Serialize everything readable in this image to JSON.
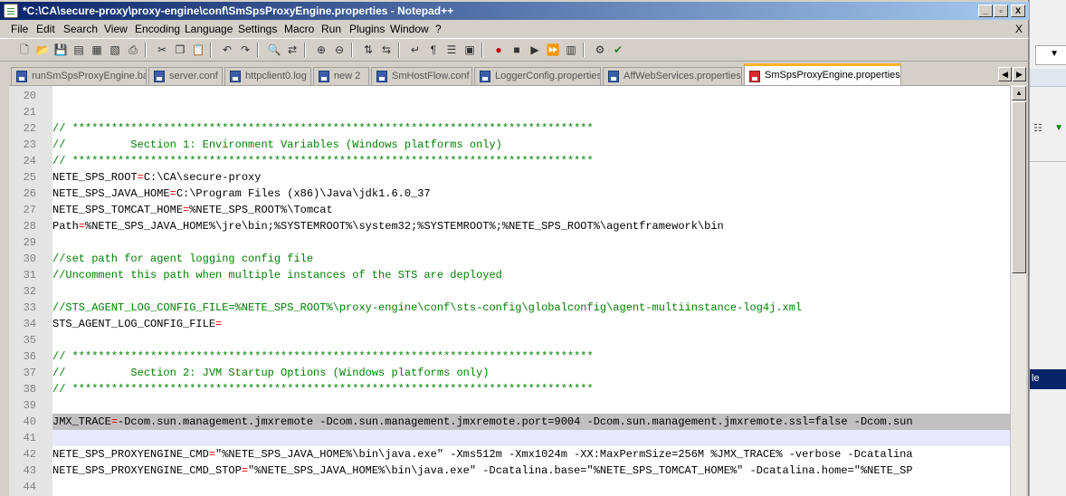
{
  "window": {
    "title": "*C:\\CA\\secure-proxy\\proxy-engine\\conf\\SmSpsProxyEngine.properties - Notepad++",
    "minimize_glyph": "_",
    "restore_glyph": "▫",
    "close_glyph": "X"
  },
  "menu": {
    "items": [
      "File",
      "Edit",
      "Search",
      "View",
      "Encoding",
      "Language",
      "Settings",
      "Macro",
      "Run",
      "Plugins",
      "Window",
      "?"
    ],
    "doc_close": "X"
  },
  "toolbar": {
    "icons": [
      "new-file-icon",
      "open-file-icon",
      "save-icon",
      "save-all-icon",
      "close-file-icon",
      "close-all-icon",
      "print-icon",
      "cut-icon",
      "copy-icon",
      "paste-icon",
      "undo-icon",
      "redo-icon",
      "find-icon",
      "replace-icon",
      "zoom-in-icon",
      "zoom-out-icon",
      "sync-vertical-icon",
      "sync-horizontal-icon",
      "word-wrap-icon",
      "show-all-chars-icon",
      "indent-guide-icon",
      "user-language-icon",
      "record-macro-icon",
      "stop-recording-icon",
      "play-macro-icon",
      "run-macro-multiple-icon",
      "save-macro-icon",
      "plugin-icon",
      "spell-check-icon"
    ]
  },
  "tabs": [
    {
      "label": "runSmSpsProxyEngine.bat",
      "active": false
    },
    {
      "label": "server.conf",
      "active": false
    },
    {
      "label": "httpclient0.log",
      "active": false
    },
    {
      "label": "new  2",
      "active": false
    },
    {
      "label": "SmHostFlow.conf",
      "active": false
    },
    {
      "label": "LoggerConfig.properties",
      "active": false
    },
    {
      "label": "AffWebServices.properties",
      "active": false
    },
    {
      "label": "SmSpsProxyEngine.properties",
      "active": true
    }
  ],
  "tab_scroll": {
    "left": "◀",
    "right": "▶"
  },
  "editor": {
    "lines": [
      {
        "n": "20",
        "parts": []
      },
      {
        "n": "21",
        "parts": []
      },
      {
        "n": "22",
        "parts": [
          {
            "t": "c",
            "s": "// ********************************************************************************"
          }
        ]
      },
      {
        "n": "23",
        "parts": [
          {
            "t": "c",
            "s": "//          Section 1: Environment Variables (Windows platforms only)"
          }
        ]
      },
      {
        "n": "24",
        "parts": [
          {
            "t": "c",
            "s": "// ********************************************************************************"
          }
        ]
      },
      {
        "n": "25",
        "parts": [
          {
            "t": "k",
            "s": "NETE_SPS_ROOT"
          },
          {
            "t": "eq",
            "s": "="
          },
          {
            "t": "v",
            "s": "C:\\CA\\secure-proxy"
          }
        ]
      },
      {
        "n": "26",
        "parts": [
          {
            "t": "k",
            "s": "NETE_SPS_JAVA_HOME"
          },
          {
            "t": "eq",
            "s": "="
          },
          {
            "t": "v",
            "s": "C:\\Program Files (x86)\\Java\\jdk1.6.0_37"
          }
        ]
      },
      {
        "n": "27",
        "parts": [
          {
            "t": "k",
            "s": "NETE_SPS_TOMCAT_HOME"
          },
          {
            "t": "eq",
            "s": "="
          },
          {
            "t": "v",
            "s": "%NETE_SPS_ROOT%\\Tomcat"
          }
        ]
      },
      {
        "n": "28",
        "parts": [
          {
            "t": "k",
            "s": "Path"
          },
          {
            "t": "eq",
            "s": "="
          },
          {
            "t": "v",
            "s": "%NETE_SPS_JAVA_HOME%\\jre\\bin;%SYSTEMROOT%\\system32;%SYSTEMROOT%;%NETE_SPS_ROOT%\\agentframework\\bin"
          }
        ]
      },
      {
        "n": "29",
        "parts": []
      },
      {
        "n": "30",
        "parts": [
          {
            "t": "c",
            "s": "//set path for agent logging config file"
          }
        ]
      },
      {
        "n": "31",
        "parts": [
          {
            "t": "c",
            "s": "//Uncomment this path when multiple instances of the STS are deployed"
          }
        ]
      },
      {
        "n": "32",
        "parts": []
      },
      {
        "n": "33",
        "parts": [
          {
            "t": "c",
            "s": "//STS_AGENT_LOG_CONFIG_FILE=%NETE_SPS_ROOT%\\proxy-engine\\conf\\sts-config\\globalconfig\\agent-multiinstance-log4j.xml"
          }
        ]
      },
      {
        "n": "34",
        "parts": [
          {
            "t": "k",
            "s": "STS_AGENT_LOG_CONFIG_FILE"
          },
          {
            "t": "eq",
            "s": "="
          }
        ]
      },
      {
        "n": "35",
        "parts": []
      },
      {
        "n": "36",
        "parts": [
          {
            "t": "c",
            "s": "// ********************************************************************************"
          }
        ]
      },
      {
        "n": "37",
        "parts": [
          {
            "t": "c",
            "s": "//          Section 2: JVM Startup Options (Windows platforms only)"
          }
        ]
      },
      {
        "n": "38",
        "parts": [
          {
            "t": "c",
            "s": "// ********************************************************************************"
          }
        ]
      },
      {
        "n": "39",
        "parts": []
      },
      {
        "n": "40",
        "sel": true,
        "parts": [
          {
            "t": "k",
            "s": "JMX_TRACE"
          },
          {
            "t": "eq",
            "s": "="
          },
          {
            "t": "v",
            "s": "-Dcom.sun.management.jmxremote -Dcom.sun.management.jmxremote.port=9004 -Dcom.sun.management.jmxremote.ssl=false -Dcom.sun"
          }
        ]
      },
      {
        "n": "41",
        "cur": true,
        "parts": []
      },
      {
        "n": "42",
        "parts": [
          {
            "t": "k",
            "s": "NETE_SPS_PROXYENGINE_CMD"
          },
          {
            "t": "eq",
            "s": "="
          },
          {
            "t": "v",
            "s": "\"%NETE_SPS_JAVA_HOME%\\bin\\java.exe\" -Xms512m -Xmx1024m -XX:MaxPermSize=256M %JMX_TRACE% -verbose -Dcatalina"
          }
        ]
      },
      {
        "n": "43",
        "parts": [
          {
            "t": "k",
            "s": "NETE_SPS_PROXYENGINE_CMD_STOP"
          },
          {
            "t": "eq",
            "s": "="
          },
          {
            "t": "v",
            "s": "\"%NETE_SPS_JAVA_HOME%\\bin\\java.exe\" -Dcatalina.base=\"%NETE_SPS_TOMCAT_HOME%\" -Dcatalina.home=\"%NETE_SP"
          }
        ]
      },
      {
        "n": "44",
        "parts": []
      }
    ]
  },
  "background_app": {
    "selected_item_text": "le"
  },
  "colors": {
    "title_active": "#0a246a",
    "active_tab_accent": "#f7b130",
    "comment": "#008000",
    "operator": "#ff0000",
    "selection": "#c0c0c0"
  }
}
